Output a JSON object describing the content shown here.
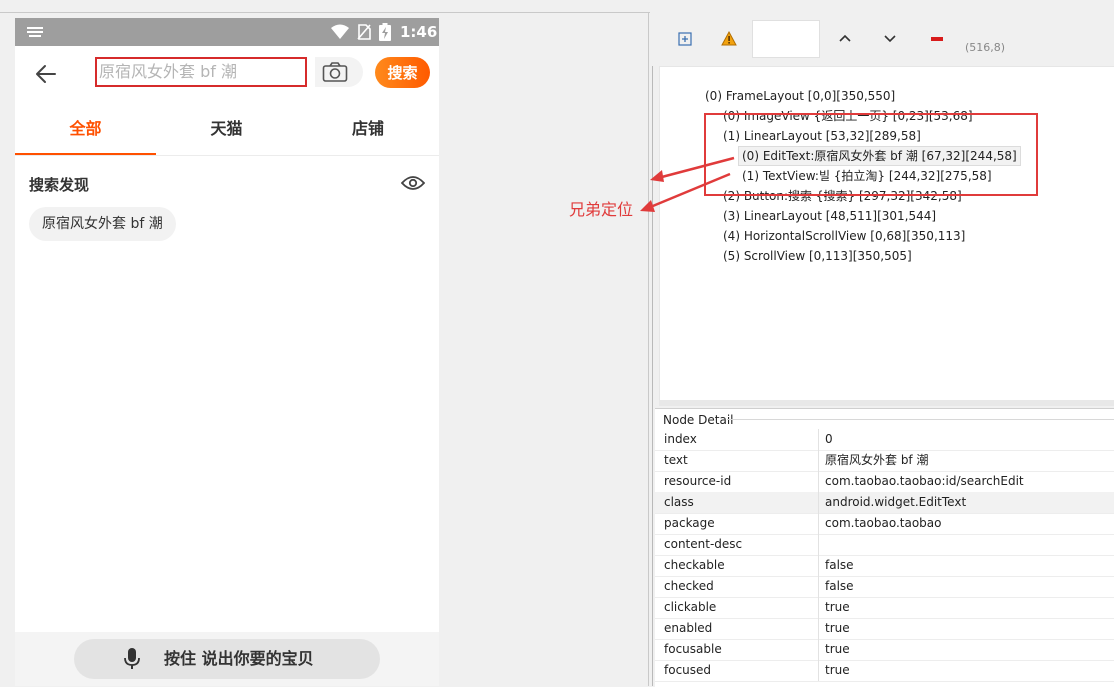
{
  "status_bar": {
    "time": "1:46"
  },
  "search": {
    "value": "原宿风女外套 bf 潮",
    "button_label": "搜索"
  },
  "tabs": [
    {
      "label": "全部"
    },
    {
      "label": "天猫"
    },
    {
      "label": "店铺"
    }
  ],
  "discovery": {
    "title": "搜索发现",
    "chips": [
      "原宿风女外套 bf 潮"
    ]
  },
  "voice": {
    "label": "按住 说出你要的宝贝"
  },
  "viewer": {
    "coords": "(516,8)",
    "tree": [
      "(0) FrameLayout [0,0][350,550]",
      "(0) ImageView {返回上一页} [0,23][53,68]",
      "(1) LinearLayout [53,32][289,58]",
      "(0) EditText:原宿风女外套 bf 潮 [67,32][244,58]",
      "(1) TextView:빌 {拍立淘} [244,32][275,58]",
      "(2) Button:搜索 {搜索} [297,32][342,58]",
      "(3) LinearLayout [48,511][301,544]",
      "(4) HorizontalScrollView [0,68][350,113]",
      "(5) ScrollView [0,113][350,505]"
    ],
    "annotation": "兄弟定位",
    "detail_title": "Node Detail",
    "details": [
      {
        "key": "index",
        "value": "0"
      },
      {
        "key": "text",
        "value": "原宿风女外套 bf 潮"
      },
      {
        "key": "resource-id",
        "value": "com.taobao.taobao:id/searchEdit"
      },
      {
        "key": "class",
        "value": "android.widget.EditText"
      },
      {
        "key": "package",
        "value": "com.taobao.taobao"
      },
      {
        "key": "content-desc",
        "value": ""
      },
      {
        "key": "checkable",
        "value": "false"
      },
      {
        "key": "checked",
        "value": "false"
      },
      {
        "key": "clickable",
        "value": "true"
      },
      {
        "key": "enabled",
        "value": "true"
      },
      {
        "key": "focusable",
        "value": "true"
      },
      {
        "key": "focused",
        "value": "true"
      }
    ],
    "selected_detail_row": 3
  },
  "colors": {
    "accent": "#ff5000",
    "annotation": "#e03b3b"
  }
}
